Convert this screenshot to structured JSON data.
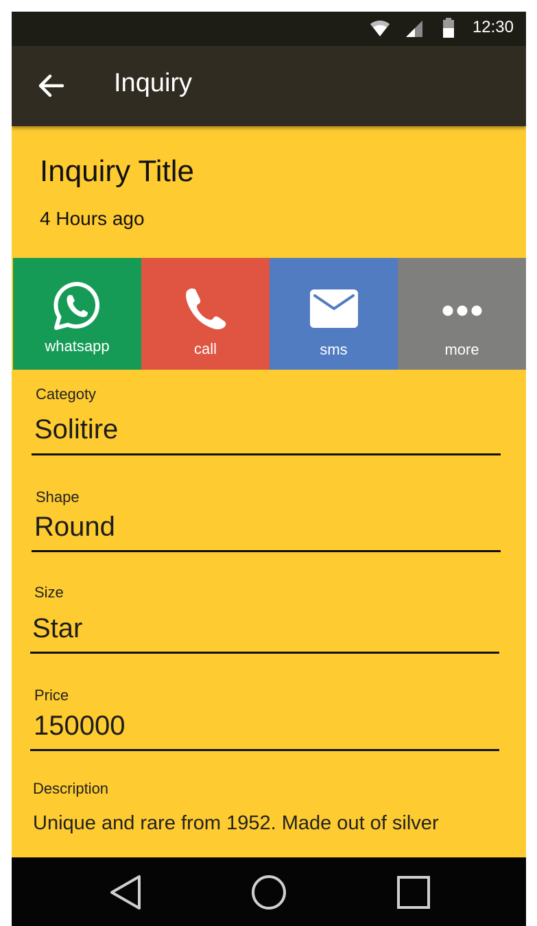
{
  "status_bar": {
    "time": "12:30",
    "icons": [
      "wifi-icon",
      "signal-icon",
      "battery-icon"
    ]
  },
  "app_bar": {
    "back_icon": "arrow-left-icon",
    "title": "Inquiry"
  },
  "inquiry": {
    "title": "Inquiry Title",
    "time_ago": "4 Hours ago"
  },
  "actions": [
    {
      "label": "whatsapp",
      "icon": "whatsapp-icon",
      "color": "#169b57"
    },
    {
      "label": "call",
      "icon": "phone-icon",
      "color": "#e05541"
    },
    {
      "label": "sms",
      "icon": "mail-icon",
      "color": "#517cc2"
    },
    {
      "label": "more",
      "icon": "more-dots-icon",
      "color": "#7f7f7e"
    }
  ],
  "fields": {
    "category": {
      "label": "Categoty",
      "value": "Solitire"
    },
    "shape": {
      "label": "Shape",
      "value": "Round"
    },
    "size": {
      "label": "Size",
      "value": "Star"
    },
    "price": {
      "label": "Price",
      "value": "150000"
    },
    "description": {
      "label": "Description",
      "value": "Unique and rare from 1952. Made out of silver"
    }
  },
  "nav_bar": {
    "icons": [
      "back-triangle-icon",
      "home-circle-icon",
      "recents-square-icon"
    ]
  },
  "colors": {
    "background": "#fecb30",
    "app_bar": "#302c22",
    "status_bar": "#1e1d15"
  }
}
